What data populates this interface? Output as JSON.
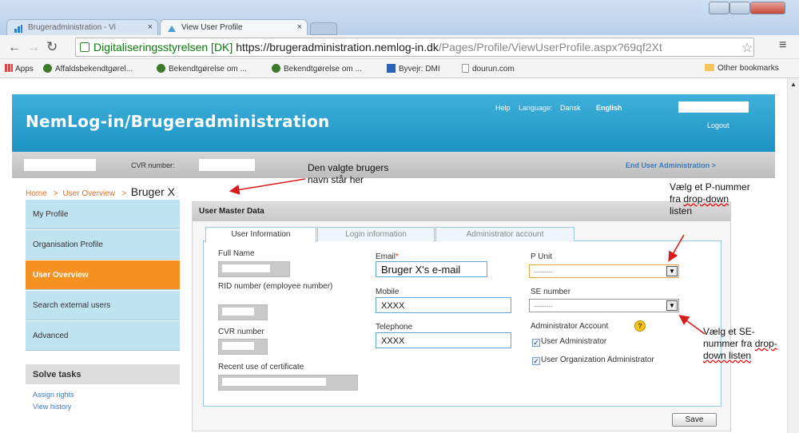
{
  "browser": {
    "tabs": [
      {
        "label": "Brugeradministration - Vi"
      },
      {
        "label": "View User Profile"
      }
    ],
    "address": {
      "org": "Digitaliseringsstyrelsen [DK]",
      "scheme_host": "https://brugeradministration.nemlog-in.dk",
      "path": "/Pages/Profile/ViewUserProfile.aspx?69qf2Xt"
    },
    "bookmarks": [
      {
        "label": "Apps"
      },
      {
        "label": "Affaldsbekendtgørel..."
      },
      {
        "label": "Bekendtgørelse om ..."
      },
      {
        "label": "Bekendtgørelse om ..."
      },
      {
        "label": "Byvejr: DMI"
      },
      {
        "label": "dourun.com"
      },
      {
        "label": "Other bookmarks"
      }
    ]
  },
  "header": {
    "title": "NemLog-in/Brugeradministration",
    "help": "Help",
    "language_label": "Language:",
    "lang_dansk": "Dansk",
    "lang_english": "English",
    "logout": "Logout"
  },
  "cvr_bar": {
    "cvr_label": "CVR number:",
    "end_admin": "End User Administration >"
  },
  "breadcrumb": {
    "home": "Home",
    "sep": ">",
    "user_overview": "User Overview",
    "current": "Bruger X"
  },
  "sidebar": {
    "items": [
      {
        "label": "My Profile"
      },
      {
        "label": "Organisation Profile"
      },
      {
        "label": "User Overview"
      },
      {
        "label": "Search external users"
      },
      {
        "label": "Advanced"
      }
    ],
    "solve_title": "Solve tasks",
    "links": [
      {
        "label": "Assign rights"
      },
      {
        "label": "View history"
      }
    ]
  },
  "panel": {
    "title": "User Master Data",
    "tabs": [
      {
        "label": "User Information"
      },
      {
        "label": "Login information"
      },
      {
        "label": "Administrator account"
      }
    ],
    "col1": {
      "full_name": "Full Name",
      "rid": "RID number (employee number)",
      "cvr": "CVR number",
      "recent": "Recent use of certificate"
    },
    "col2": {
      "email_label": "Email",
      "email_required": "*",
      "email_value": "Bruger X's e-mail",
      "mobile_label": "Mobile",
      "mobile_value": "XXXX",
      "telephone_label": "Telephone",
      "telephone_value": "XXXX"
    },
    "col3": {
      "punit_label": "P Unit",
      "punit_value": "---------",
      "se_label": "SE number",
      "se_value": "---------",
      "admin_account_label": "Administrator Account",
      "help_glyph": "?",
      "chk_user_admin": "User Administrator",
      "chk_org_admin": "User Organization Administrator"
    },
    "save": "Save"
  },
  "annotations": {
    "selected_user_line1": "Den valgte brugers",
    "selected_user_line2": "navn står her",
    "punit_a": "Vælg et P-nummer",
    "punit_b1": "fra ",
    "punit_b2": "drop-down",
    "punit_c": "listen",
    "se_a": "Vælg et SE-",
    "se_b1": "nummer fra ",
    "se_b2": "drop-",
    "se_c": "down listen"
  },
  "colors": {
    "header_blue": "#1d93c5",
    "active_orange": "#f79222",
    "link_orange": "#e07020",
    "annotation_arrow": "#d81b1b"
  }
}
